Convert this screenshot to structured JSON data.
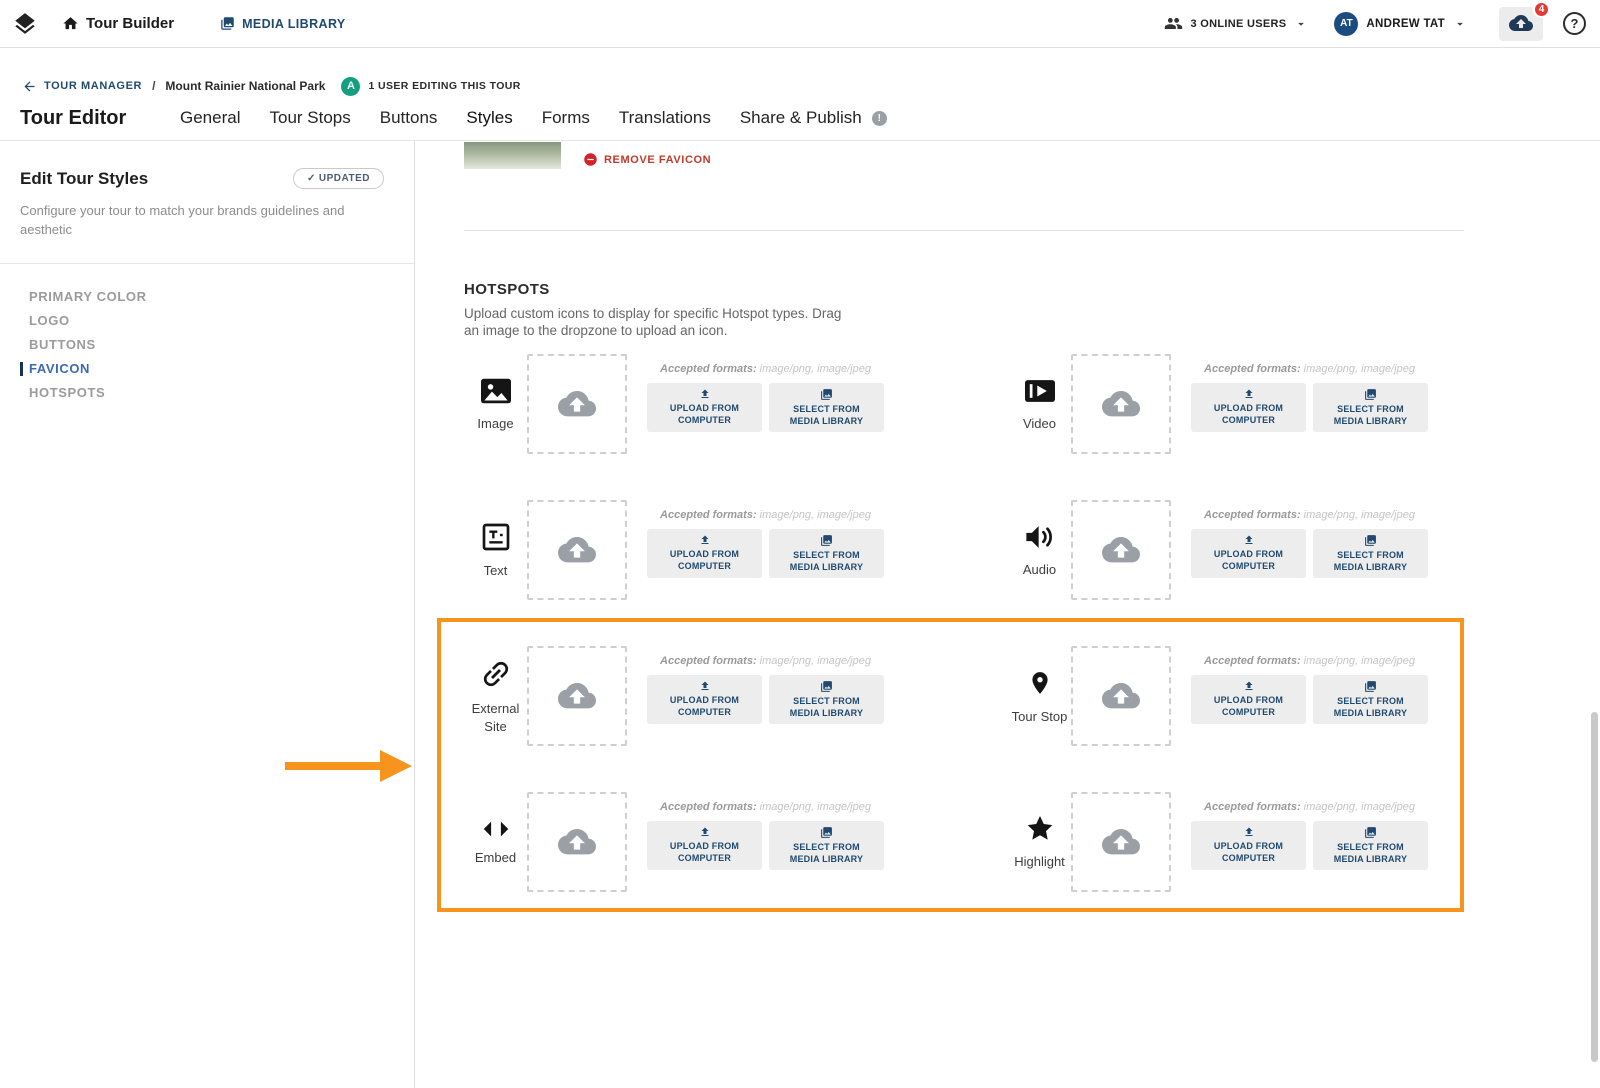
{
  "topnav": {
    "brand_label": "Tour Builder",
    "media_library_label": "MEDIA LIBRARY",
    "online_users_label": "3 ONLINE USERS",
    "user_initials": "AT",
    "user_name": "ANDREW TAT",
    "notification_count": "4",
    "help_glyph": "?"
  },
  "breadcrumb": {
    "back_label": "TOUR MANAGER",
    "separator": "/",
    "tour_name": "Mount Rainier National Park",
    "editing_user_initial": "A",
    "editing_label": "1 USER EDITING THIS TOUR"
  },
  "editor": {
    "title": "Tour Editor",
    "tabs": [
      {
        "label": "General"
      },
      {
        "label": "Tour Stops"
      },
      {
        "label": "Buttons"
      },
      {
        "label": "Styles"
      },
      {
        "label": "Forms"
      },
      {
        "label": "Translations"
      },
      {
        "label": "Share & Publish"
      }
    ],
    "active_tab": "Styles",
    "info_glyph": "!"
  },
  "sidebar": {
    "title": "Edit Tour Styles",
    "updated_check": "✓",
    "updated_badge": "UPDATED",
    "description": "Configure your tour to match your brands guidelines and aesthetic",
    "items": [
      {
        "label": "PRIMARY COLOR",
        "active": false
      },
      {
        "label": "LOGO",
        "active": false
      },
      {
        "label": "BUTTONS",
        "active": false
      },
      {
        "label": "FAVICON",
        "active": true
      },
      {
        "label": "HOTSPOTS",
        "active": false
      }
    ]
  },
  "favicon_section": {
    "remove_label": "REMOVE FAVICON"
  },
  "hotspots": {
    "title": "HOTSPOTS",
    "description": "Upload custom icons to display for specific Hotspot types. Drag an image to the dropzone to upload an icon.",
    "accepted_formats_label": "Accepted formats:",
    "accepted_formats_value": "image/png, image/jpeg",
    "upload_button": "UPLOAD FROM COMPUTER",
    "select_button": "SELECT FROM MEDIA LIBRARY",
    "types": [
      {
        "label": "Image"
      },
      {
        "label": "Video"
      },
      {
        "label": "Text"
      },
      {
        "label": "Audio"
      },
      {
        "label": "External Site"
      },
      {
        "label": "Tour Stop"
      },
      {
        "label": "Embed"
      },
      {
        "label": "Highlight"
      }
    ]
  },
  "colors": {
    "accent_orange": "#F7941E",
    "navy": "#1F4A70",
    "active_link_blue": "#3B6BB4",
    "danger_red": "#C0392B",
    "online_green": "#14A07F",
    "badge_red": "#E53935"
  }
}
